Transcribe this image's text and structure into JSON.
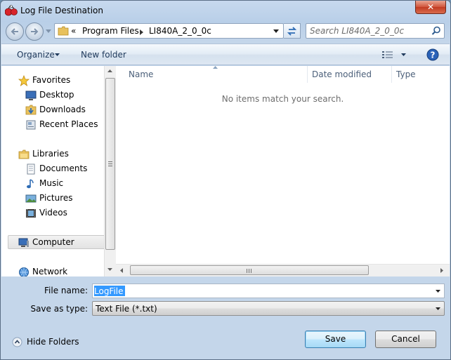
{
  "window": {
    "title": "Log File Destination",
    "close_label": "✕"
  },
  "address_bar": {
    "overflow": "«",
    "crumbs": [
      "Program Files",
      "LI840A_2_0_0c"
    ]
  },
  "search": {
    "placeholder": "Search LI840A_2_0_0c"
  },
  "toolbar": {
    "organize_label": "Organize",
    "new_folder_label": "New folder"
  },
  "nav_pane": {
    "favorites": {
      "label": "Favorites",
      "items": [
        "Desktop",
        "Downloads",
        "Recent Places"
      ]
    },
    "libraries": {
      "label": "Libraries",
      "items": [
        "Documents",
        "Music",
        "Pictures",
        "Videos"
      ]
    },
    "computer": {
      "label": "Computer"
    },
    "network": {
      "label": "Network"
    }
  },
  "file_list": {
    "columns": [
      "Name",
      "Date modified",
      "Type"
    ],
    "empty_message": "No items match your search."
  },
  "form": {
    "file_name_label": "File name:",
    "file_name_value": "LogFile",
    "save_as_type_label": "Save as type:",
    "save_as_type_value": "Text File (*.txt)"
  },
  "footer": {
    "hide_folders_label": "Hide Folders",
    "save_label": "Save",
    "cancel_label": "Cancel"
  }
}
